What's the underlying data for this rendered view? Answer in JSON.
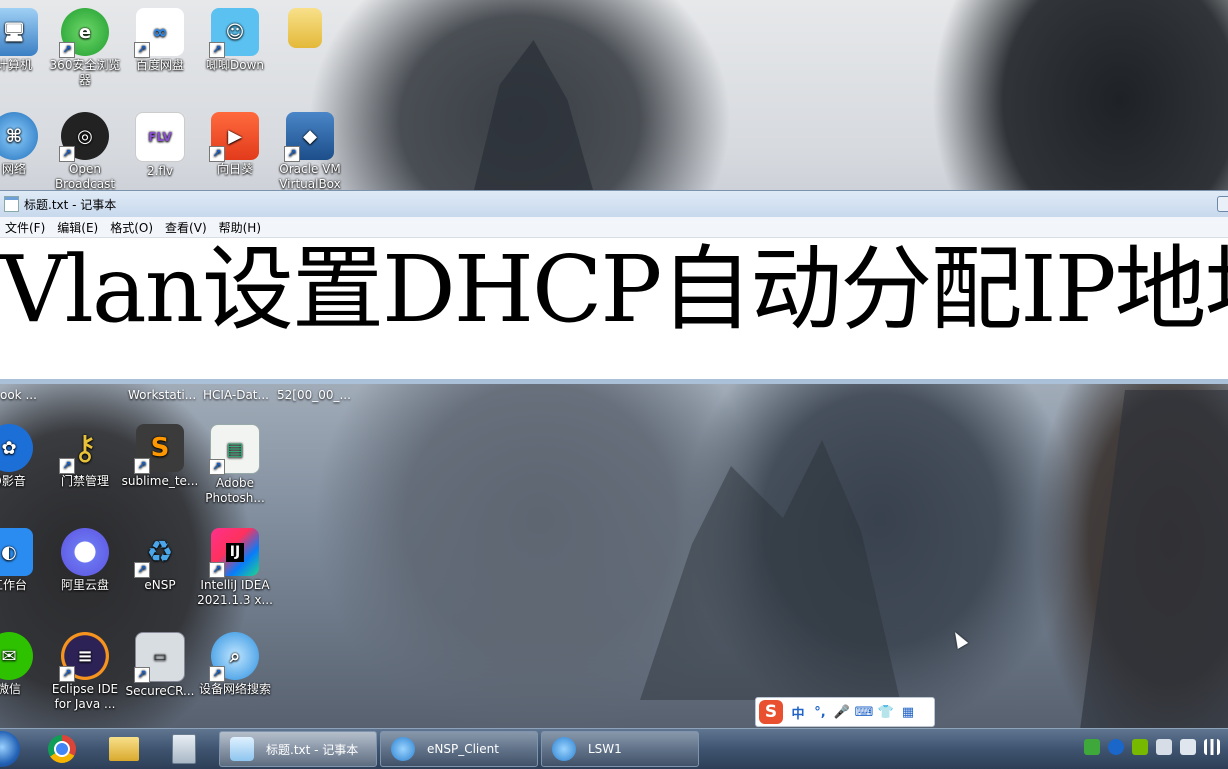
{
  "desktop": {
    "icons_top_row1": [
      {
        "name": "computer",
        "label": "计算机",
        "icon": "computer-icon"
      },
      {
        "name": "360-browser",
        "label": "360安全浏览器",
        "icon": "browser-360-icon"
      },
      {
        "name": "baidu-netdisk",
        "label": "百度网盘",
        "icon": "baidu-netdisk-icon"
      },
      {
        "name": "bilibili-down",
        "label": "唧唧Down",
        "icon": "jijidown-icon"
      },
      {
        "name": "folder",
        "label": "",
        "icon": "folder-icon"
      }
    ],
    "icons_top_row2": [
      {
        "name": "network",
        "label": "网络",
        "icon": "network-icon"
      },
      {
        "name": "obs",
        "label": "Open Broadcast",
        "icon": "obs-icon"
      },
      {
        "name": "flv-file",
        "label": "2.flv",
        "icon": "flv-file-icon"
      },
      {
        "name": "xiangrikui",
        "label": "向日葵",
        "icon": "sunlogin-icon"
      },
      {
        "name": "virtualbox",
        "label": "Oracle VM VirtualBox",
        "icon": "virtualbox-icon"
      }
    ],
    "strip_labels": [
      "ook ...",
      "Workstati...",
      "HCIA-Dat...",
      "52[00_00_..."
    ],
    "icons_row3": [
      {
        "name": "qq-video",
        "label": "Q影音",
        "icon": "qq-video-icon"
      },
      {
        "name": "door-access",
        "label": "门禁管理",
        "icon": "keys-icon"
      },
      {
        "name": "sublime",
        "label": "sublime_te...",
        "icon": "sublime-icon"
      },
      {
        "name": "photoshop",
        "label": "Adobe Photosh...",
        "icon": "photoshop-icon"
      }
    ],
    "icons_row4": [
      {
        "name": "dingtalk-workbench",
        "label": "工作台",
        "icon": "dingtalk-icon"
      },
      {
        "name": "aliyun-drive",
        "label": "阿里云盘",
        "icon": "aliyun-drive-icon"
      },
      {
        "name": "ensp",
        "label": "eNSP",
        "icon": "ensp-icon"
      },
      {
        "name": "intellij",
        "label": "IntelliJ IDEA 2021.1.3 x...",
        "icon": "intellij-icon"
      }
    ],
    "icons_row5": [
      {
        "name": "wechat",
        "label": "微信",
        "icon": "wechat-icon"
      },
      {
        "name": "eclipse",
        "label": "Eclipse IDE for Java ...",
        "icon": "eclipse-icon"
      },
      {
        "name": "securecrt",
        "label": "SecureCR...",
        "icon": "securecrt-icon"
      },
      {
        "name": "device-search",
        "label": "设备网络搜索",
        "icon": "device-search-icon"
      }
    ]
  },
  "notepad": {
    "title": "标题.txt - 记事本",
    "menu": [
      "文件(F)",
      "编辑(E)",
      "格式(O)",
      "查看(V)",
      "帮助(H)"
    ],
    "content": "Vlan设置DHCP自动分配IP地址"
  },
  "ime": {
    "logo": "S",
    "items": [
      "中",
      "°,",
      "🎤",
      "⌨",
      "👕",
      "▦"
    ]
  },
  "taskbar": {
    "pinned": [
      "chrome-icon",
      "explorer-icon",
      "calculator-icon"
    ],
    "windows": [
      {
        "label": "标题.txt - 记事本",
        "icon": "notepad-icon",
        "active": true
      },
      {
        "label": "eNSP_Client",
        "icon": "ensp-icon",
        "active": false
      },
      {
        "label": "LSW1",
        "icon": "ensp-icon",
        "active": false
      }
    ]
  },
  "colors": {
    "taskbar": "#3f5470",
    "notepad_title": "#c8d9ed",
    "ime_logo": "#e8502f",
    "ime_accent": "#1f63c6"
  }
}
